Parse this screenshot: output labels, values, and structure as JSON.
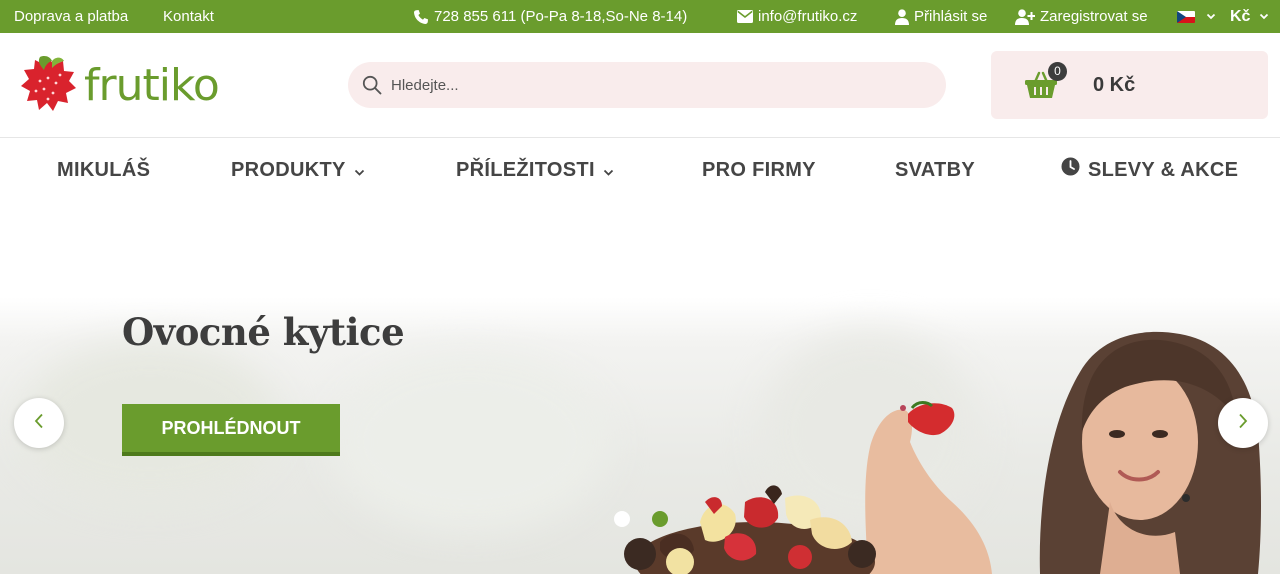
{
  "topbar": {
    "shipping_link": "Doprava a platba",
    "contact_link": "Kontakt",
    "phone": "728 855 611 (Po-Pa 8-18,So-Ne 8-14)",
    "email": "info@frutiko.cz",
    "login": "Přihlásit se",
    "register": "Zaregistrovat se",
    "currency": "Kč",
    "language_flag": "flag-cz-icon"
  },
  "header": {
    "logo_text": "frutiko",
    "search_placeholder": "Hledejte...",
    "cart_count": "0",
    "cart_total": "0 Kč"
  },
  "nav": {
    "items": [
      {
        "label": "MIKULÁŠ"
      },
      {
        "label": "PRODUKTY"
      },
      {
        "label": "PŘÍLEŽITOSTI"
      },
      {
        "label": "PRO FIRMY"
      },
      {
        "label": "SVATBY"
      },
      {
        "label": "SLEVY & AKCE"
      }
    ]
  },
  "hero": {
    "title": "Ovocné kytice",
    "button_label": "PROHLÉDNOUT",
    "active_slide": 2,
    "slide_count": 2
  },
  "colors": {
    "brand_green": "#6a9c2d",
    "brand_red": "#d9232d",
    "search_bg": "#f9ecec",
    "text_dark": "#454545"
  },
  "icons": {
    "phone": "phone-icon",
    "email": "envelope-icon",
    "login": "user-icon",
    "register": "user-plus-icon",
    "search": "search-icon",
    "cart": "basket-icon",
    "dropdown": "chevron-down-icon",
    "sale": "clock-icon",
    "prev": "chevron-left-icon",
    "next": "chevron-right-icon"
  }
}
